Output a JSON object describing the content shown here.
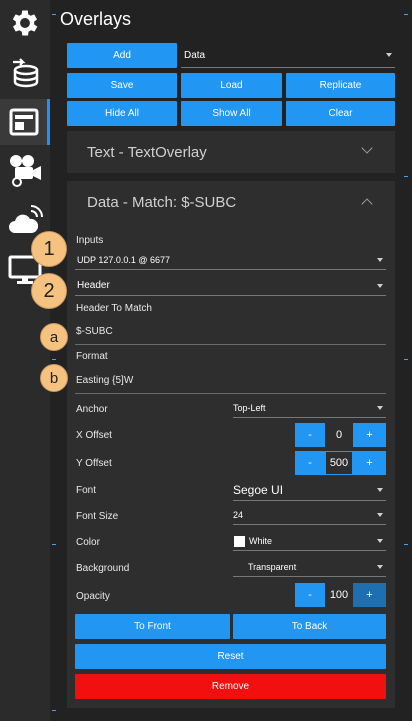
{
  "colors": {
    "accent": "#2196f3",
    "danger": "#f20f0f",
    "badge": "#f6c27f"
  },
  "sidebar": {
    "items": [
      {
        "name": "gear-icon"
      },
      {
        "name": "database-import-icon"
      },
      {
        "name": "layout-overlay-icon"
      },
      {
        "name": "video-settings-icon"
      },
      {
        "name": "cloud-stream-icon"
      },
      {
        "name": "monitor-icon"
      }
    ]
  },
  "header": {
    "title": "Overlays"
  },
  "toolbar": {
    "add_label": "Add",
    "type_value": "Data",
    "save_label": "Save",
    "load_label": "Load",
    "replicate_label": "Replicate",
    "hide_all_label": "Hide All",
    "show_all_label": "Show All",
    "clear_label": "Clear"
  },
  "panels": {
    "text": {
      "title": "Text - TextOverlay"
    },
    "data": {
      "title": "Data - Match: $-SUBC"
    }
  },
  "form": {
    "inputs_label": "Inputs",
    "inputs_value": "UDP 127.0.0.1 @ 6677",
    "match_mode_value": "Header",
    "header_to_match_label": "Header To Match",
    "header_to_match_value": "$-SUBC",
    "format_label": "Format",
    "format_value": "Easting {5]W",
    "anchor_label": "Anchor",
    "anchor_value": "Top-Left",
    "x_offset_label": "X Offset",
    "x_offset_value": "0",
    "y_offset_label": "Y Offset",
    "y_offset_value": "500",
    "font_label": "Font",
    "font_value": "Segoe UI",
    "font_size_label": "Font Size",
    "font_size_value": "24",
    "color_label": "Color",
    "color_value": "White",
    "background_label": "Background",
    "background_value": "Transparent",
    "opacity_label": "Opacity",
    "opacity_value": "100",
    "minus": "-",
    "plus": "+"
  },
  "actions": {
    "to_front_label": "To Front",
    "to_back_label": "To Back",
    "reset_label": "Reset",
    "remove_label": "Remove"
  },
  "badges": {
    "one": "1",
    "two": "2",
    "a": "a",
    "b": "b"
  }
}
